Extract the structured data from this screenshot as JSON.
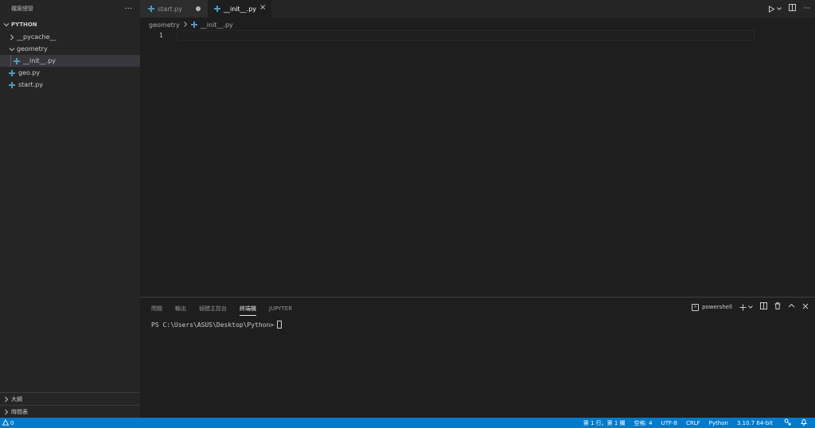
{
  "sidebar": {
    "title": "檔案總管",
    "more": "···",
    "root": "PYTHON",
    "items": [
      {
        "label": "__pycache__"
      },
      {
        "label": "geometry"
      },
      {
        "label": "__init__.py"
      },
      {
        "label": "geo.py"
      },
      {
        "label": "start.py"
      }
    ],
    "outline": "大綱",
    "timeline": "時間表"
  },
  "tabs": [
    {
      "label": "start.py"
    },
    {
      "label": "__init__.py"
    }
  ],
  "breadcrumb": {
    "folder": "geometry",
    "file": "__init__.py"
  },
  "editor": {
    "line_number": "1"
  },
  "panel": {
    "tabs": [
      "問題",
      "輸出",
      "偵錯主控台",
      "終端機",
      "JUPYTER"
    ],
    "terminal_name": "powershell",
    "prompt": "PS C:\\Users\\ASUS\\Desktop\\Python>"
  },
  "status": {
    "errors": "0",
    "position": "第 1 行，第 1 欄",
    "spaces": "空格: 4",
    "encoding": "UTF-8",
    "eol": "CRLF",
    "language": "Python",
    "interpreter": "3.10.7 64-bit"
  },
  "colors": {
    "accent": "#007acc",
    "python_icon": "#519aba"
  }
}
